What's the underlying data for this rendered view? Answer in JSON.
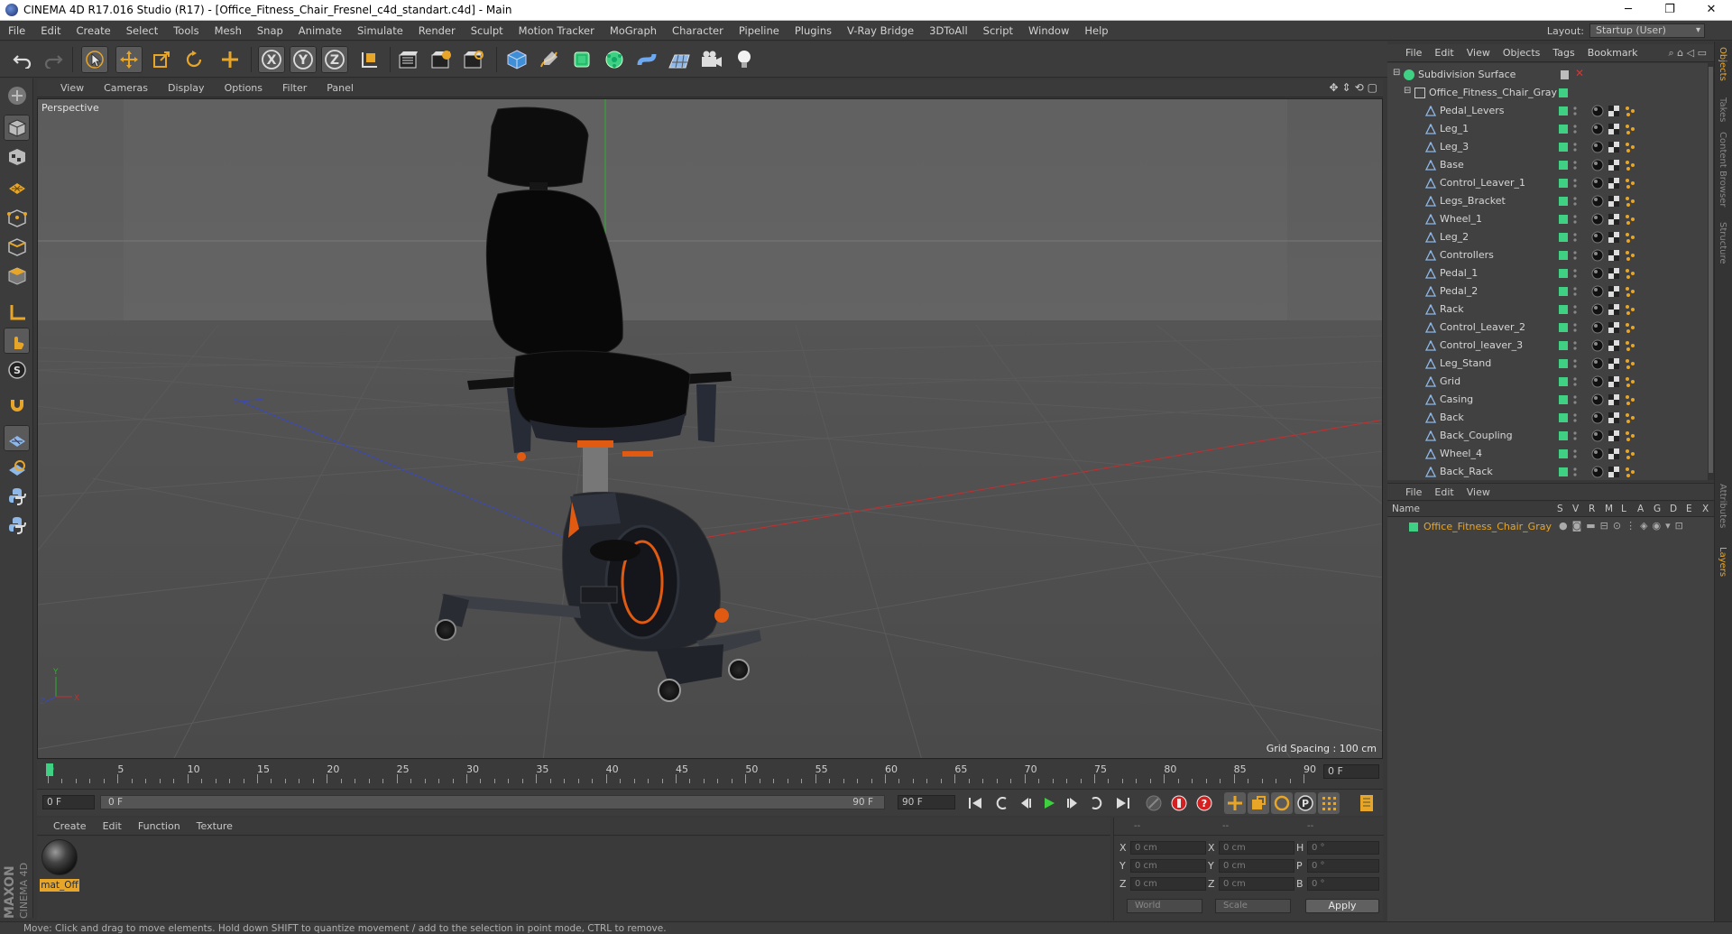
{
  "window": {
    "title": "CINEMA 4D R17.016 Studio (R17) - [Office_Fitness_Chair_Fresnel_c4d_standart.c4d] - Main",
    "minimize": "─",
    "restore": "❐",
    "close": "✕"
  },
  "menu": [
    "File",
    "Edit",
    "Create",
    "Select",
    "Tools",
    "Mesh",
    "Snap",
    "Animate",
    "Simulate",
    "Render",
    "Sculpt",
    "Motion Tracker",
    "MoGraph",
    "Character",
    "Pipeline",
    "Plugins",
    "V-Ray Bridge",
    "3DToAll",
    "Script",
    "Window",
    "Help"
  ],
  "layout": {
    "label": "Layout:",
    "value": "Startup (User)"
  },
  "viewport": {
    "menu": [
      "View",
      "Cameras",
      "Display",
      "Options",
      "Filter",
      "Panel"
    ],
    "camera_label": "Perspective",
    "grid_spacing": "Grid Spacing : 100 cm"
  },
  "timeline": {
    "ticks": [
      "0",
      "5",
      "10",
      "15",
      "20",
      "25",
      "30",
      "35",
      "40",
      "45",
      "50",
      "55",
      "60",
      "65",
      "70",
      "75",
      "80",
      "85",
      "90"
    ],
    "current_frame": "0 F"
  },
  "transport": {
    "start_field": "0 F",
    "range_start": "0 F",
    "range_end": "90 F",
    "end_field": "90 F"
  },
  "material_manager": {
    "menu": [
      "Create",
      "Edit",
      "Function",
      "Texture"
    ],
    "material_name": "mat_Off"
  },
  "coordinates": {
    "header": [
      "--",
      "--",
      "--"
    ],
    "rows": [
      {
        "a": "X",
        "av": "0 cm",
        "b": "X",
        "bv": "0 cm",
        "c": "H",
        "cv": "0 °"
      },
      {
        "a": "Y",
        "av": "0 cm",
        "b": "Y",
        "bv": "0 cm",
        "c": "P",
        "cv": "0 °"
      },
      {
        "a": "Z",
        "av": "0 cm",
        "b": "Z",
        "bv": "0 cm",
        "c": "B",
        "cv": "0 °"
      }
    ],
    "world": "World",
    "scale": "Scale",
    "apply": "Apply"
  },
  "object_manager": {
    "menu": [
      "File",
      "Edit",
      "View",
      "Objects",
      "Tags",
      "Bookmark"
    ],
    "root": "Subdivision Surface",
    "group": "Office_Fitness_Chair_Gray",
    "children": [
      "Pedal_Levers",
      "Leg_1",
      "Leg_3",
      "Base",
      "Control_Leaver_1",
      "Legs_Bracket",
      "Wheel_1",
      "Leg_2",
      "Controllers",
      "Pedal_1",
      "Pedal_2",
      "Rack",
      "Control_Leaver_2",
      "Control_leaver_3",
      "Leg_Stand",
      "Grid",
      "Casing",
      "Back",
      "Back_Coupling",
      "Wheel_4",
      "Back_Rack"
    ]
  },
  "layer_manager": {
    "menu": [
      "File",
      "Edit",
      "View"
    ],
    "columns": [
      "Name",
      "S",
      "V",
      "R",
      "M",
      "L",
      "A",
      "G",
      "D",
      "E",
      "X"
    ],
    "layer_name": "Office_Fitness_Chair_Gray"
  },
  "side_tabs": [
    "Objects",
    "Takes",
    "Content Browser",
    "Structure",
    "Attributes",
    "Layers"
  ],
  "status": "Move: Click and drag to move elements. Hold down SHIFT to quantize movement / add to the selection in point mode, CTRL to remove.",
  "colors": {
    "accent": "#e8a628",
    "layer_green": "#3fd083",
    "bg": "#383838"
  }
}
